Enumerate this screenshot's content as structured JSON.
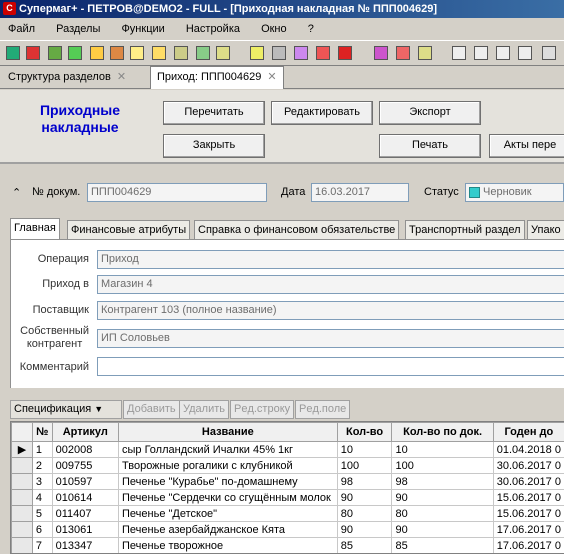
{
  "window": {
    "title": "Супермаг+ - ПЕТРОВ@DEMO2 - FULL - [Приходная накладная № ППП004629]"
  },
  "menu": [
    "Файл",
    "Разделы",
    "Функции",
    "Настройка",
    "Окно",
    "?"
  ],
  "doc_tabs": [
    {
      "label": "Структура разделов"
    },
    {
      "label": "Приход: ППП004629"
    }
  ],
  "header": {
    "title_line1": "Приходные",
    "title_line2": "накладные",
    "buttons": {
      "reread": "Перечитать",
      "edit": "Редактировать",
      "export": "Экспорт",
      "close": "Закрыть",
      "print": "Печать",
      "transport": "Акты пере"
    }
  },
  "doc": {
    "number_label": "№ докум.",
    "number": "ППП004629",
    "date_label": "Дата",
    "date": "16.03.2017",
    "status_label": "Статус",
    "status": "Черновик"
  },
  "inner_tabs": [
    "Главная",
    "Финансовые атрибуты",
    "Справка о финансовом обязательстве",
    "Транспортный раздел",
    "Упако"
  ],
  "main": {
    "operation_label": "Операция",
    "operation": "Приход",
    "incoming_label": "Приход в",
    "incoming": "Магазин 4",
    "supplier_label": "Поставщик",
    "supplier": "Контрагент 103 (полное название)",
    "own_label_line1": "Собственный",
    "own_label_line2": "контрагент",
    "own": "ИП Соловьев",
    "comment_label": "Комментарий",
    "comment": ""
  },
  "spec": {
    "menu": "Спецификация",
    "add": "Добавить",
    "delete": "Удалить",
    "row_props": "Рeд.строку",
    "field_props": "Рeд.поле"
  },
  "table": {
    "columns": [
      "№",
      "Артикул",
      "Название",
      "Кол-во",
      "Кол-во по док.",
      "Годен до"
    ],
    "rows": [
      [
        "1",
        "002008",
        "сыр Голландский Ичалки 45% 1кг",
        "10",
        "10",
        "01.04.2018 0"
      ],
      [
        "2",
        "009755",
        "Творожные рогалики с клубникой",
        "100",
        "100",
        "30.06.2017 0"
      ],
      [
        "3",
        "010597",
        "Печенье \"Курабье\" по-домашнему",
        "98",
        "98",
        "30.06.2017 0"
      ],
      [
        "4",
        "010614",
        "Печенье \"Сердечки со сгущённым молок",
        "90",
        "90",
        "15.06.2017 0"
      ],
      [
        "5",
        "011407",
        "Печенье \"Детское\"",
        "80",
        "80",
        "15.06.2017 0"
      ],
      [
        "6",
        "013061",
        "Печенье азербайджанское Кята",
        "90",
        "90",
        "17.06.2017 0"
      ],
      [
        "7",
        "013347",
        "Печенье творожное",
        "85",
        "85",
        "17.06.2017 0"
      ]
    ]
  }
}
